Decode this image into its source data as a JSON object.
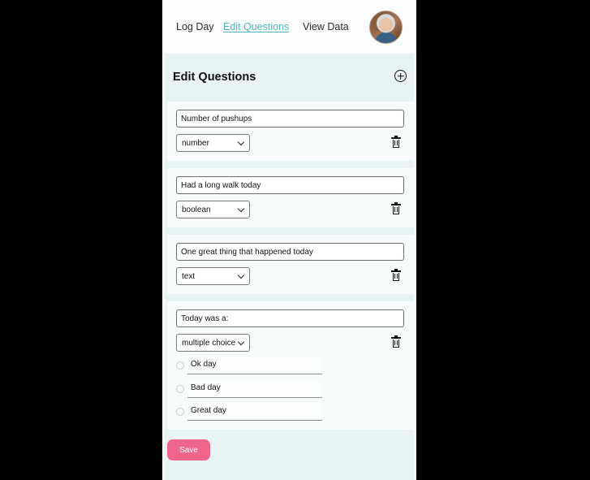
{
  "nav": {
    "links": [
      {
        "label": "Log Day",
        "active": false
      },
      {
        "label": "Edit Questions",
        "active": true
      },
      {
        "label": "View Data",
        "active": false
      }
    ],
    "avatar_icon": "user-avatar-photo"
  },
  "page": {
    "title": "Edit Questions",
    "add_icon": "plus-circle-icon"
  },
  "questions": [
    {
      "text": "Number of pushups",
      "type": "number"
    },
    {
      "text": "Had a long walk today",
      "type": "boolean"
    },
    {
      "text": "One great thing that happened today",
      "type": "text"
    },
    {
      "text": "Today was a:",
      "type": "multiple choice",
      "options": [
        "Ok day",
        "Bad day",
        "Great day"
      ]
    }
  ],
  "save_label": "Save",
  "colors": {
    "accent": "#4fb3bf",
    "save_button": "#f0668a",
    "panel_background": "#e8f3f4",
    "frame_background": "#000000"
  }
}
